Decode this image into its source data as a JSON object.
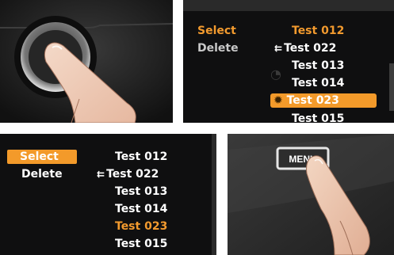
{
  "colors": {
    "accent": "#f29a2e",
    "panel_bg": "#0f0f10",
    "text": "#ffffff",
    "muted": "#c9c9c9"
  },
  "panel_top_right": {
    "actions": [
      "Select",
      "Delete"
    ],
    "items": [
      {
        "label": "Test 012",
        "state": "active-orange",
        "icon": ""
      },
      {
        "label": "Test 022",
        "state": "normal",
        "icon": "usb-icon"
      },
      {
        "label": "Test 013",
        "state": "normal",
        "icon": ""
      },
      {
        "label": "Test 014",
        "state": "normal",
        "icon": ""
      },
      {
        "label": "Test 023",
        "state": "highlighted",
        "icon": "sun-icon"
      },
      {
        "label": "Test 015",
        "state": "normal",
        "icon": ""
      }
    ]
  },
  "panel_bottom_left": {
    "actions": [
      "Select",
      "Delete"
    ],
    "items": [
      {
        "label": "Test 012",
        "state": "normal",
        "icon": ""
      },
      {
        "label": "Test 022",
        "state": "normal",
        "icon": "usb-icon"
      },
      {
        "label": "Test 013",
        "state": "normal",
        "icon": ""
      },
      {
        "label": "Test 014",
        "state": "normal",
        "icon": ""
      },
      {
        "label": "Test 023",
        "state": "active-orange",
        "icon": ""
      },
      {
        "label": "Test 015",
        "state": "normal",
        "icon": ""
      }
    ]
  },
  "panel_bottom_right": {
    "button_label": "MENU"
  }
}
